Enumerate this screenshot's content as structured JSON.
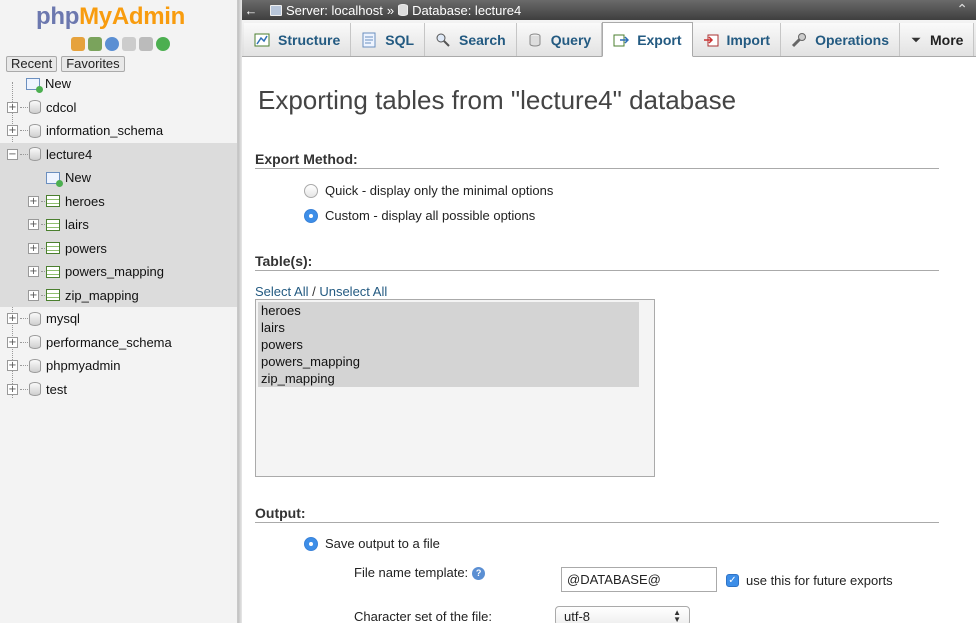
{
  "sidebar": {
    "logo": {
      "php": "php",
      "my": "My",
      "admin": "Admin"
    },
    "quick_icons": [
      "home-icon",
      "exit-icon",
      "help-icon",
      "docs-icon",
      "settings-icon",
      "reload-icon"
    ],
    "tabs": {
      "recent": "Recent",
      "favorites": "Favorites"
    },
    "tree": {
      "new": "New",
      "databases": [
        {
          "name": "cdcol"
        },
        {
          "name": "information_schema"
        },
        {
          "name": "lecture4",
          "selected": true,
          "children_new": "New",
          "tables": [
            "heroes",
            "lairs",
            "powers",
            "powers_mapping",
            "zip_mapping"
          ]
        },
        {
          "name": "mysql"
        },
        {
          "name": "performance_schema"
        },
        {
          "name": "phpmyadmin"
        },
        {
          "name": "test"
        }
      ]
    }
  },
  "topbar": {
    "back": "←",
    "server_label": "Server: localhost",
    "separator": "»",
    "database_label": "Database: lecture4",
    "collapse": "⌃"
  },
  "tabs": [
    {
      "label": "Structure",
      "icon": "structure-icon"
    },
    {
      "label": "SQL",
      "icon": "sql-icon"
    },
    {
      "label": "Search",
      "icon": "search-icon"
    },
    {
      "label": "Query",
      "icon": "query-icon"
    },
    {
      "label": "Export",
      "icon": "export-icon",
      "active": true
    },
    {
      "label": "Import",
      "icon": "import-icon"
    },
    {
      "label": "Operations",
      "icon": "operations-icon"
    },
    {
      "label": "More",
      "icon": "chevron-down-icon"
    }
  ],
  "main": {
    "title": "Exporting tables from \"lecture4\" database",
    "export_method": {
      "heading": "Export Method:",
      "quick": "Quick - display only the minimal options",
      "custom": "Custom - display all possible options",
      "selected": "custom"
    },
    "tables": {
      "heading": "Table(s):",
      "select_all": "Select All",
      "divider": " / ",
      "unselect_all": "Unselect All",
      "items": [
        "heroes",
        "lairs",
        "powers",
        "powers_mapping",
        "zip_mapping"
      ]
    },
    "output": {
      "heading": "Output:",
      "save_to_file": "Save output to a file",
      "file_name_template_label": "File name template:",
      "file_name_template_value": "@DATABASE@",
      "use_for_future": "use this for future exports",
      "use_for_future_checked": true,
      "charset_label": "Character set of the file:",
      "charset_value": "utf-8"
    }
  },
  "colors": {
    "link": "#235a81",
    "radio_checked": "#3d8ee8",
    "logo_php": "#6c78af",
    "logo_myadmin": "#f89c0e"
  }
}
